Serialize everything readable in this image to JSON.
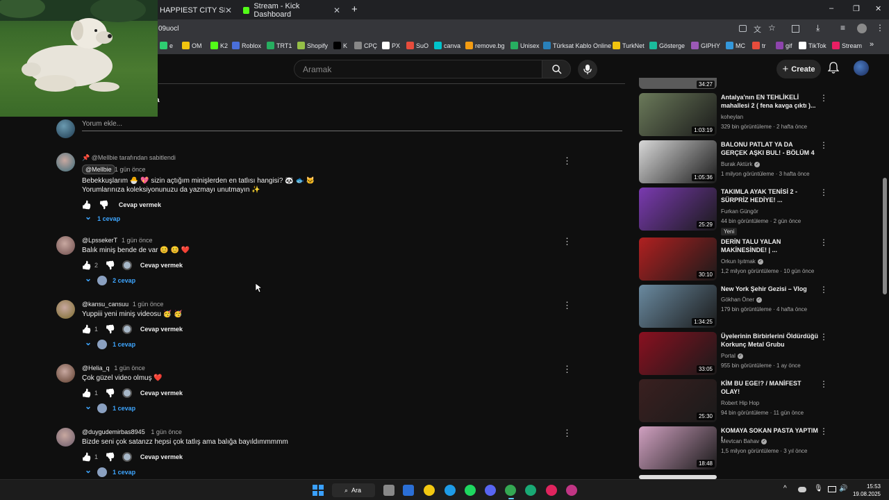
{
  "browser": {
    "tabs": [
      {
        "title": "HAPPIEST CITY SINOP VLOG"
      },
      {
        "title": "Stream - Kick Dashboard"
      }
    ],
    "new_tab_label": "+",
    "url": "09uocl",
    "window_controls": [
      "–",
      "❐",
      "✕"
    ],
    "bookmarks": [
      {
        "label": "e",
        "color": "#2ecc71"
      },
      {
        "label": "OM",
        "color": "#f1c40f"
      },
      {
        "label": "K2",
        "color": "#53fc18"
      },
      {
        "label": "Roblox",
        "color": "#4a6fd9"
      },
      {
        "label": "TRT1",
        "color": "#27ae60"
      },
      {
        "label": "Shopify",
        "color": "#95bf47"
      },
      {
        "label": "K",
        "color": "#000000"
      },
      {
        "label": "CPÇ",
        "color": "#888888"
      },
      {
        "label": "PX",
        "color": "#ffffff"
      },
      {
        "label": "SuO",
        "color": "#e74c3c"
      },
      {
        "label": "canva",
        "color": "#00c4cc"
      },
      {
        "label": "remove.bg",
        "color": "#f39c12"
      },
      {
        "label": "Unisex",
        "color": "#27ae60"
      },
      {
        "label": "Türksat Kablo Online",
        "color": "#2980b9"
      },
      {
        "label": "TurkNet",
        "color": "#f1c40f"
      },
      {
        "label": "Gösterge",
        "color": "#1abc9c"
      },
      {
        "label": "GIPHY",
        "color": "#9b59b6"
      },
      {
        "label": "MC",
        "color": "#3498db"
      },
      {
        "label": "tr",
        "color": "#e74c3c"
      },
      {
        "label": "gif",
        "color": "#8e44ad"
      },
      {
        "label": "TikTok",
        "color": "#ffffff"
      },
      {
        "label": "Stream",
        "color": "#e91e63"
      }
    ],
    "more_bookmarks": "»"
  },
  "youtube": {
    "search_placeholder": "Aramak",
    "create_label": "Create",
    "create_plus": "+"
  },
  "overlay": {
    "partial_text": "a"
  },
  "comments": {
    "add_placeholder": "Yorum ekle...",
    "items": [
      {
        "pinned": "📌 @Mellbie tarafından sabitlendi",
        "author": "@Mellbie",
        "time": "1 gün önce",
        "text_lines": [
          "Bebekkuşlarım 🐣 💖 sizin açtığım minişlerden en tatlısı hangisi? 🐼 🐟 🐱",
          "Yorumlarınıza koleksiyonunuzu da yazmayı unutmayın ✨"
        ],
        "likes": "",
        "reply_label": "Cevap vermek",
        "replies": "1 cevap",
        "avatar_color": "#3a6b7a"
      },
      {
        "author": "@LpssekerT",
        "time": "1 gün önce",
        "text_lines": [
          "Balık miniş bende de var 😊 😊 ❤️"
        ],
        "likes": "2",
        "reply_label": "Cevap vermek",
        "replies": "2 cevap",
        "avatar_color": "#6b4a4a"
      },
      {
        "author": "@kansu_cansuu",
        "time": "1 gün önce",
        "text_lines": [
          "Yuppiii yeni miniş videosu 🥳 🥳"
        ],
        "likes": "1",
        "reply_label": "Cevap vermek",
        "replies": "1 cevap",
        "avatar_color": "#7a6a2a"
      },
      {
        "author": "@Helia_q",
        "time": "1 gün önce",
        "text_lines": [
          "Çok güzel video olmuş ❤️"
        ],
        "likes": "1",
        "reply_label": "Cevap vermek",
        "replies": "1 cevap",
        "avatar_color": "#5a3a2a"
      },
      {
        "author": "@duygudemirbas8945",
        "time": "1 gün önce",
        "text_lines": [
          "Bizde seni çok satanzz hepsi çok tatlış ama balığa bayıldımmmmm"
        ],
        "likes": "1",
        "reply_label": "Cevap vermek",
        "replies": "1 cevap",
        "avatar_color": "#6a5a6a"
      }
    ]
  },
  "sidebar": {
    "top_partial_duration": "34:27",
    "videos": [
      {
        "title": "Antalya'nın EN TEHLİKELİ mahallesi 2 ( fena kavga çıktı )...",
        "channel": "koheylan",
        "meta": "329 bin görüntüleme · 2 hafta önce",
        "duration": "1:03:19",
        "thumb_color": "#6b7a5a",
        "verified": false,
        "badge": ""
      },
      {
        "title": "BALONU PATLAT YA DA GERÇEK AŞKI BUL! - BÖLÜM 4",
        "channel": "Burak Aktürk",
        "meta": "1 milyon görüntüleme · 3 hafta önce",
        "duration": "1:05:36",
        "thumb_color": "#d8d8d8",
        "verified": true,
        "badge": ""
      },
      {
        "title": "TAKIMLA AYAK TENİSİ 2 - SÜRPRİZ HEDİYE! ...",
        "channel": "Furkan Güngör",
        "meta": "44 bin görüntüleme · 2 gün önce",
        "duration": "25:29",
        "thumb_color": "#7a3ab0",
        "verified": false,
        "badge": "Yeni"
      },
      {
        "title": "DERİN TALU YALAN MAKİNESİNDE! | ...",
        "channel": "Orkun Işıtmak",
        "meta": "1,2 milyon görüntüleme · 10 gün önce",
        "duration": "30:10",
        "thumb_color": "#b02020",
        "verified": true,
        "badge": ""
      },
      {
        "title": "New York Şehir Gezisi – Vlog",
        "channel": "Gökhan Öner",
        "meta": "179 bin görüntüleme · 4 hafta önce",
        "duration": "1:34:25",
        "thumb_color": "#6a8aa0",
        "verified": true,
        "badge": ""
      },
      {
        "title": "Üyelerinin Birbirlerini Öldürdüğü Korkunç Metal Grubu",
        "channel": "Portal",
        "meta": "955 bin görüntüleme · 1 ay önce",
        "duration": "33:05",
        "thumb_color": "#8a1020",
        "verified": true,
        "badge": ""
      },
      {
        "title": "KİM BU EGE!? / MANİFEST OLAY!",
        "channel": "Robert Hip Hop",
        "meta": "94 bin görüntüleme · 11 gün önce",
        "duration": "25:30",
        "thumb_color": "#3a2020",
        "verified": false,
        "badge": ""
      },
      {
        "title": "KOMAYA SOKAN PASTA YAPTIM !",
        "channel": "Mevtcan Bahav",
        "meta": "1,5 milyon görüntüleme · 3 yıl önce",
        "duration": "18:48",
        "thumb_color": "#d0a0c0",
        "verified": true,
        "badge": ""
      }
    ]
  },
  "taskbar": {
    "search_label": "Ara",
    "time": "15:53",
    "date": "19.08.2025",
    "app_colors": [
      "#2b6fd6",
      "#f2c811",
      "#1e9be6",
      "#1ed760",
      "#5865f2",
      "#34a853",
      "#19a974",
      "#e0245e",
      "#c13584"
    ]
  }
}
